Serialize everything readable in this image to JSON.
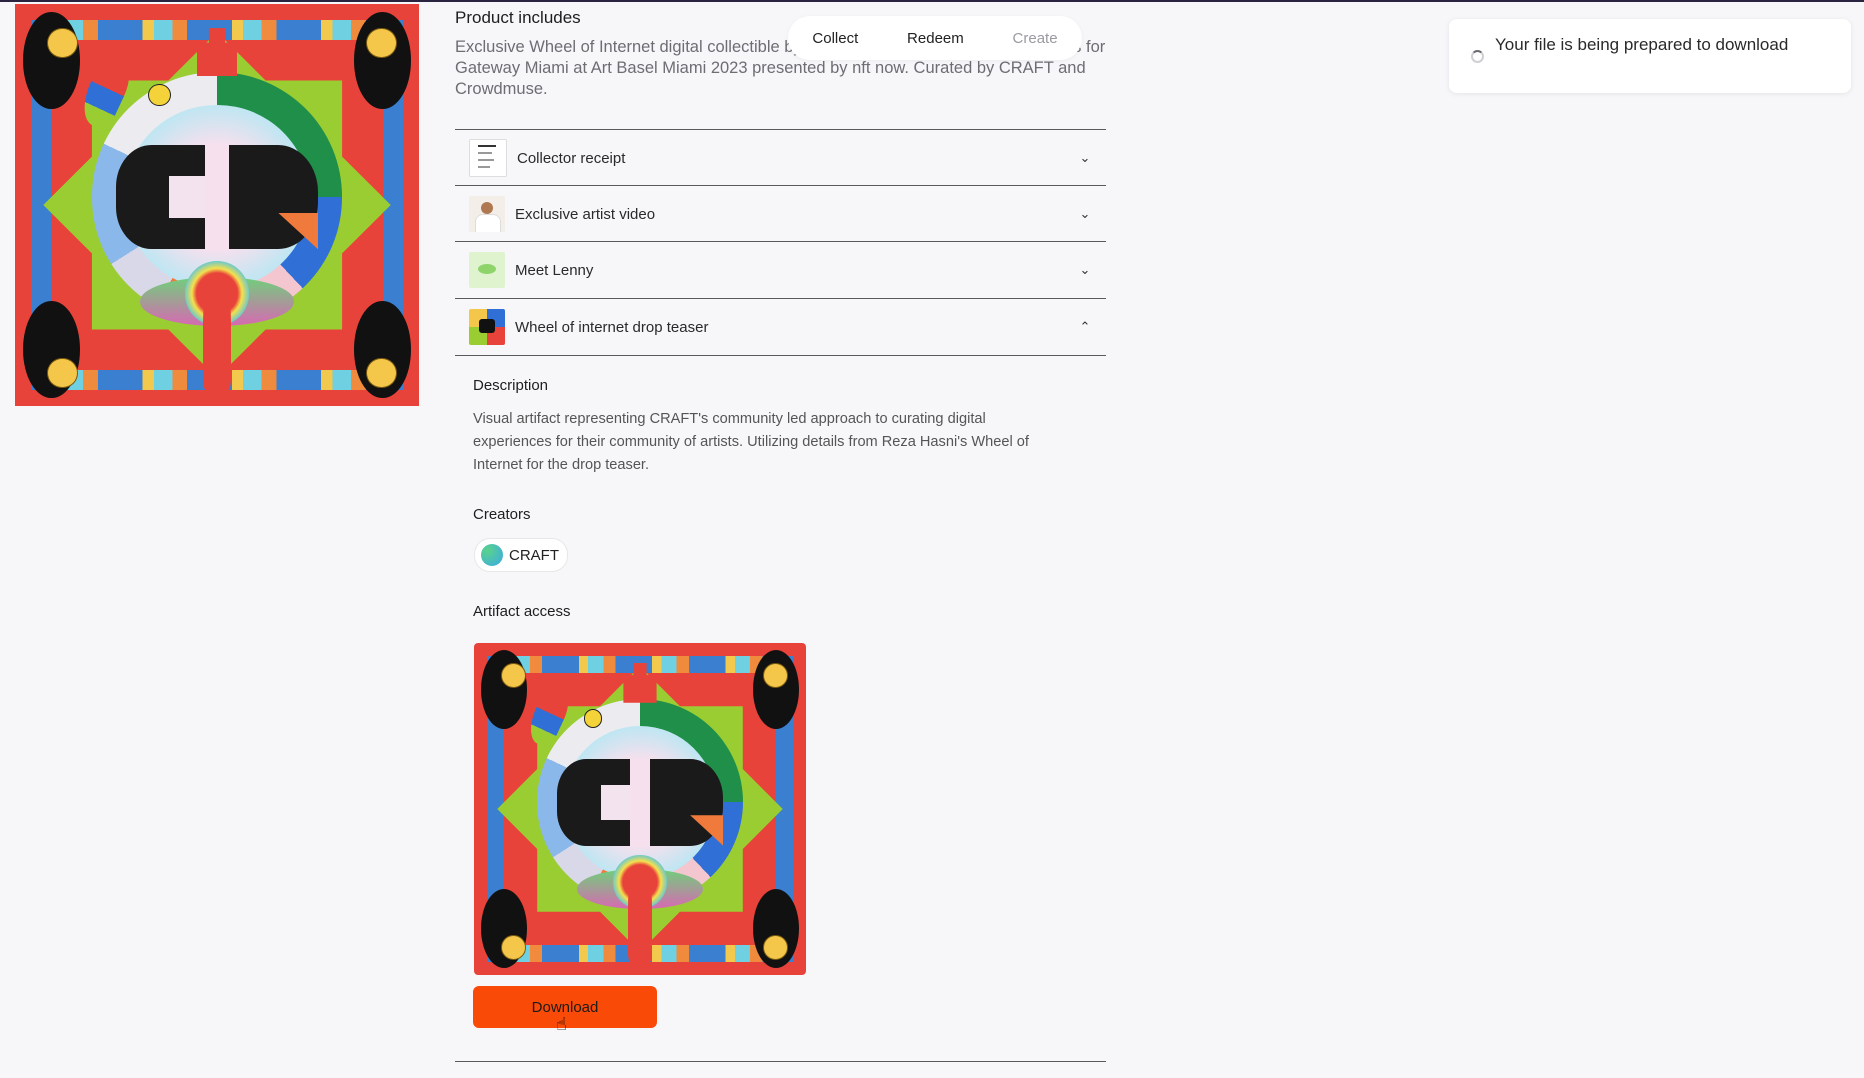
{
  "toolbar": {
    "collect": "Collect",
    "redeem": "Redeem",
    "create": "Create"
  },
  "product": {
    "title": "Product includes",
    "description": "Exclusive Wheel of Internet digital collectible by Reza Hasni in collaboration with Lens for Gateway Miami at Art Basel Miami 2023 presented by nft now. Curated by CRAFT and Crowdmuse."
  },
  "accordion": [
    {
      "label": "Collector receipt",
      "thumb": "receipt-thumbnail",
      "expanded": false
    },
    {
      "label": "Exclusive artist video",
      "thumb": "artist-video-thumbnail",
      "expanded": false
    },
    {
      "label": "Meet Lenny",
      "thumb": "lenny-thumbnail",
      "expanded": false
    },
    {
      "label": "Wheel of internet drop teaser",
      "thumb": "wheel-thumbnail",
      "expanded": true
    }
  ],
  "details": {
    "description_heading": "Description",
    "description_text": "Visual artifact representing CRAFT's community led approach to curating digital experiences for their community of artists. Utilizing details from Reza Hasni's Wheel of Internet for the drop teaser.",
    "creators_heading": "Creators",
    "creator_name": "CRAFT",
    "artifact_heading": "Artifact access",
    "download_label": "Download"
  },
  "toast": {
    "message": "Your file is being prepared to download",
    "icon": "spinner-icon"
  },
  "colors": {
    "accent": "#fa4a07",
    "background": "#f7f7fa",
    "divider": "#5a5a5a"
  }
}
